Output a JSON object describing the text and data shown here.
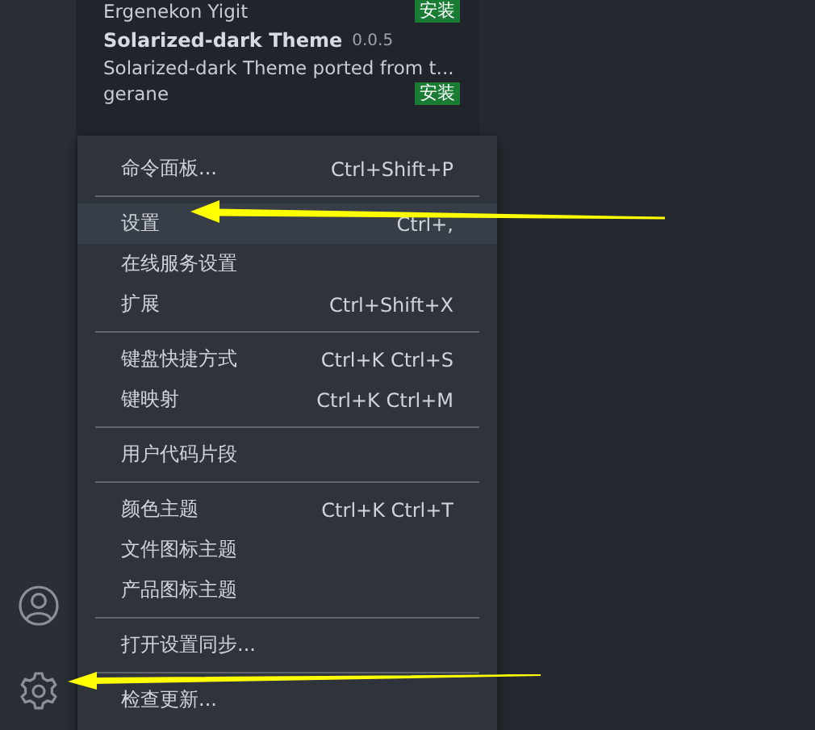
{
  "extensions": [
    {
      "name": "Ergenekon Yigit",
      "install_label": "安装",
      "kind": "author-only"
    },
    {
      "name": "Solarized-dark Theme",
      "version": "0.0.5",
      "description": "Solarized-dark Theme ported from t...",
      "author": "gerane",
      "install_label": "安装",
      "kind": "full"
    }
  ],
  "menu": [
    {
      "kind": "item",
      "label": "命令面板...",
      "shortcut": "Ctrl+Shift+P",
      "selected": false
    },
    {
      "kind": "separator"
    },
    {
      "kind": "item",
      "label": "设置",
      "shortcut": "Ctrl+,",
      "selected": true
    },
    {
      "kind": "item",
      "label": "在线服务设置",
      "selected": false
    },
    {
      "kind": "item",
      "label": "扩展",
      "shortcut": "Ctrl+Shift+X",
      "selected": false
    },
    {
      "kind": "separator"
    },
    {
      "kind": "item",
      "label": "键盘快捷方式",
      "shortcut": "Ctrl+K Ctrl+S",
      "selected": false
    },
    {
      "kind": "item",
      "label": "键映射",
      "shortcut": "Ctrl+K Ctrl+M",
      "selected": false
    },
    {
      "kind": "separator"
    },
    {
      "kind": "item",
      "label": "用户代码片段",
      "selected": false
    },
    {
      "kind": "separator"
    },
    {
      "kind": "item",
      "label": "颜色主题",
      "shortcut": "Ctrl+K Ctrl+T",
      "selected": false
    },
    {
      "kind": "item",
      "label": "文件图标主题",
      "selected": false
    },
    {
      "kind": "item",
      "label": "产品图标主题",
      "selected": false
    },
    {
      "kind": "separator"
    },
    {
      "kind": "item",
      "label": "打开设置同步...",
      "selected": false
    },
    {
      "kind": "separator"
    },
    {
      "kind": "item",
      "label": "检查更新...",
      "selected": false
    }
  ]
}
